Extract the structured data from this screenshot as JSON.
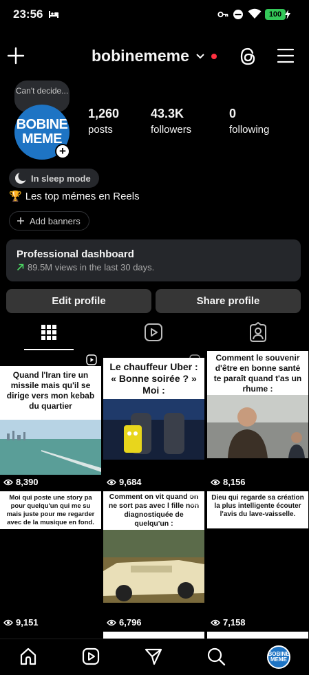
{
  "status_bar": {
    "time": "23:56",
    "battery": "100"
  },
  "header": {
    "username": "bobinememe",
    "icons": [
      "plus-icon",
      "chevron-down-icon",
      "threads-icon",
      "hamburger-menu-icon"
    ]
  },
  "profile": {
    "note": "Can't decide...",
    "avatar_text": [
      "BOBINE",
      "MEME"
    ],
    "stats": [
      {
        "value": "1,260",
        "label": "posts"
      },
      {
        "value": "43.3K",
        "label": "followers"
      },
      {
        "value": "0",
        "label": "following"
      }
    ],
    "sleep_mode": "In sleep mode",
    "bio_emoji": "🏆",
    "bio": "Les top mémes en Reels",
    "add_banners": "Add banners"
  },
  "dashboard": {
    "title": "Professional dashboard",
    "subtitle": "89.5M views in the last 30 days."
  },
  "buttons": {
    "edit": "Edit profile",
    "share": "Share profile"
  },
  "tabs": [
    "grid-icon",
    "reels-icon",
    "tagged-icon"
  ],
  "posts": [
    {
      "caption": "Quand l'Iran tire un missile mais qu'il se dirige vers mon kebab du quartier",
      "views": "8,390"
    },
    {
      "caption": "Le chauffeur Uber : « Bonne soirée ? » Moi :",
      "views": "9,684"
    },
    {
      "caption": "Comment le souvenir d'être en bonne santé te paraît quand t'as un rhume :",
      "views": "8,156"
    },
    {
      "caption": "Moi qui poste une story pa pour quelqu'un qui me su mais juste pour me regarder avec de la musique en fond.",
      "views": "9,151"
    },
    {
      "caption": "Comment on vit quand on ne sort pas avec l fille non diagnostiquée de quelqu'un :",
      "views": "6,796"
    },
    {
      "caption": "Dieu qui regarde sa création la plus intelligente écouter l'avis du lave-vaisselle.",
      "views": "7,158"
    }
  ],
  "colors": {
    "accent_green": "#34c759",
    "brand_blue": "#1e74c4",
    "notification_red": "#ff3040",
    "button_bg": "#363636"
  },
  "bottom_nav": [
    "home-icon",
    "reels-icon",
    "messages-icon",
    "search-icon",
    "profile-avatar"
  ]
}
